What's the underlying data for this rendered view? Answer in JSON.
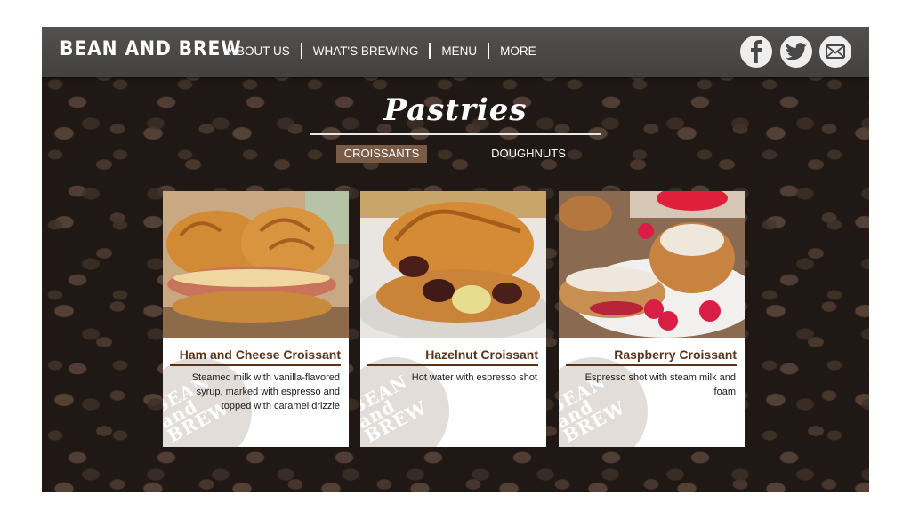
{
  "brand": {
    "name": "BEAN AND BREW"
  },
  "nav": {
    "items": [
      "ABOUT US",
      "WHAT'S BREWING",
      "MENU",
      "MORE"
    ]
  },
  "social": {
    "icons": [
      "facebook-icon",
      "twitter-icon",
      "email-icon"
    ]
  },
  "section": {
    "title": "Pastries"
  },
  "tabs": {
    "items": [
      {
        "label": "CROISSANTS",
        "active": true
      },
      {
        "label": "DOUGHNUTS",
        "active": false
      }
    ]
  },
  "watermark": {
    "text": "BEAN and BREW"
  },
  "cards": [
    {
      "title": "Ham and Cheese Croissant",
      "description": "Steamed milk with vanilla-flavored syrup, marked with espresso and topped with caramel drizzle",
      "image": "ham-and-cheese-croissant-photo"
    },
    {
      "title": "Hazelnut Croissant",
      "description": "Hot water with espresso shot",
      "image": "hazelnut-croissant-photo"
    },
    {
      "title": "Raspberry Croissant",
      "description": "Espresso shot with steam milk and foam",
      "image": "raspberry-croissant-photo"
    }
  ],
  "colors": {
    "accent": "#7a5c46",
    "card_title": "#5a3216",
    "topbar": "#4a4846"
  }
}
